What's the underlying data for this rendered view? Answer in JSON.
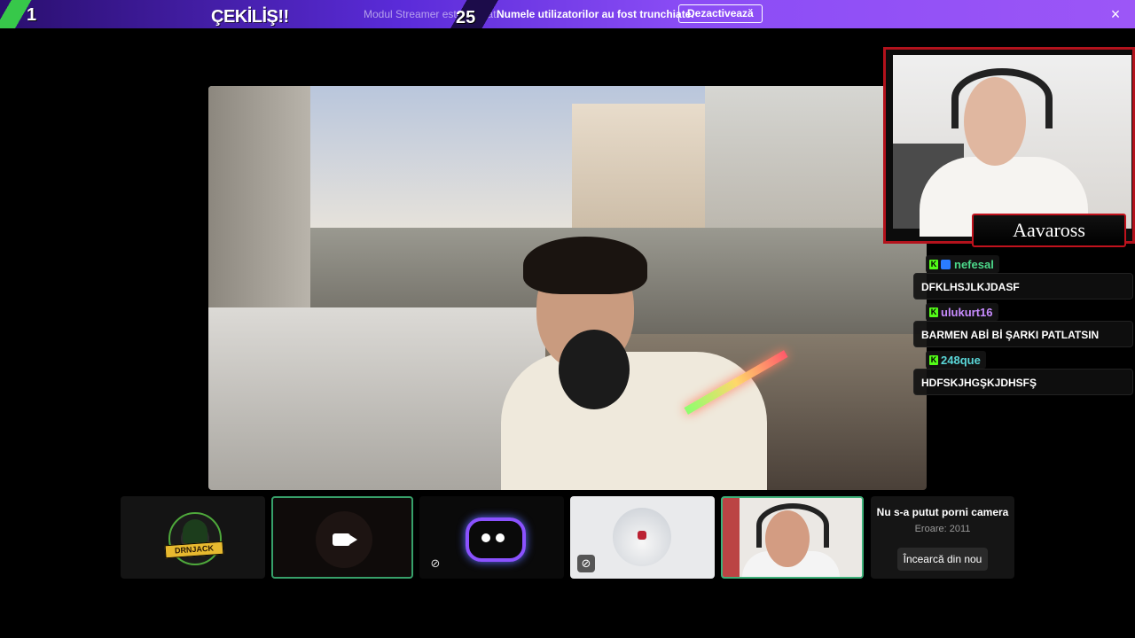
{
  "banner": {
    "counter_left": "1",
    "title": "ÇEKİLİŞ!!",
    "faded_notice": "Modul Streamer este activat.",
    "counter_right": "25",
    "notice": "Numele utilizatorilor au fost trunchiate.",
    "deactivate_label": "Dezactivează",
    "close_icon": "×",
    "accent_color": "#8a4cf5"
  },
  "host_cam": {
    "name": "Aavaross"
  },
  "chat": {
    "messages": [
      {
        "user": "nefesal",
        "user_color": "#4cd88a",
        "badges": [
          "kick-icon",
          "sub-icon"
        ],
        "text": "DFKLHSJLKJDASF"
      },
      {
        "user": "ulukurt16",
        "user_color": "#c88cff",
        "badges": [
          "kick-icon"
        ],
        "text": "BARMEN ABİ Bİ ŞARKI PATLATSIN"
      },
      {
        "user": "248que",
        "user_color": "#5ad6d8",
        "badges": [
          "kick-icon"
        ],
        "text": "HDFSKJHGŞKJDHSFŞ"
      }
    ]
  },
  "participants": {
    "dornjack_logo_text": "DRNJACK",
    "camera_error": {
      "title": "Nu s-a putut porni camera",
      "code": "Eroare: 2011",
      "retry_label": "Încearcă din nou"
    }
  }
}
